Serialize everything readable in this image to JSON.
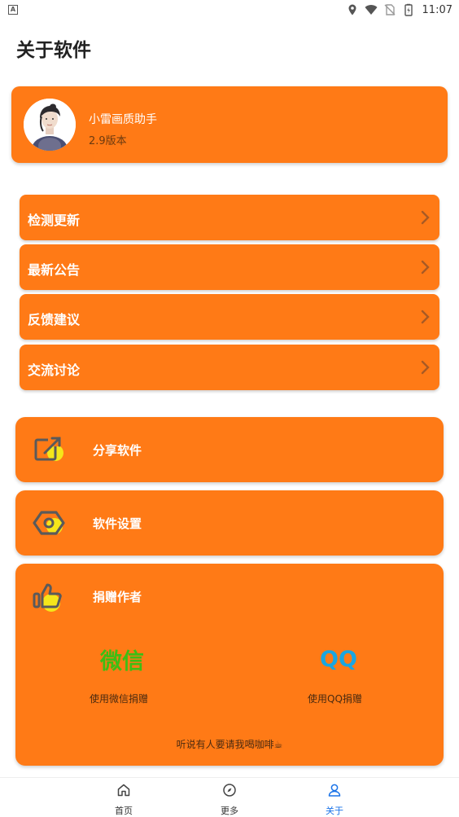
{
  "status_bar": {
    "time": "11:07",
    "left_icon": "accessibility-a-icon",
    "icons": [
      "location-icon",
      "wifi-icon",
      "no-sim-icon",
      "battery-charging-icon"
    ]
  },
  "page": {
    "title": "关于软件"
  },
  "profile": {
    "app_name": "小雷画质助手",
    "version": "2.9版本"
  },
  "menu": [
    {
      "label": "检测更新"
    },
    {
      "label": "最新公告"
    },
    {
      "label": "反馈建议"
    },
    {
      "label": "交流讨论"
    }
  ],
  "actions": {
    "share": {
      "label": "分享软件",
      "icon": "share-edit-icon"
    },
    "settings": {
      "label": "软件设置",
      "icon": "settings-nut-icon"
    }
  },
  "donate": {
    "label": "捐赠作者",
    "icon": "thumbs-up-icon",
    "wechat_title": "微信",
    "wechat_caption": "使用微信捐赠",
    "qq_title": "QQ",
    "qq_caption": "使用QQ捐赠",
    "coffee_text": "听说有人要请我喝咖啡☕"
  },
  "bottom_nav": [
    {
      "label": "首页",
      "icon": "home-icon",
      "active": false
    },
    {
      "label": "更多",
      "icon": "compass-icon",
      "active": false
    },
    {
      "label": "关于",
      "icon": "person-icon",
      "active": true
    }
  ],
  "colors": {
    "accent": "#FF7A16",
    "wechat_green": "#3DBE14",
    "qq_blue": "#1AA6E0",
    "active_nav": "#1a73e8"
  }
}
